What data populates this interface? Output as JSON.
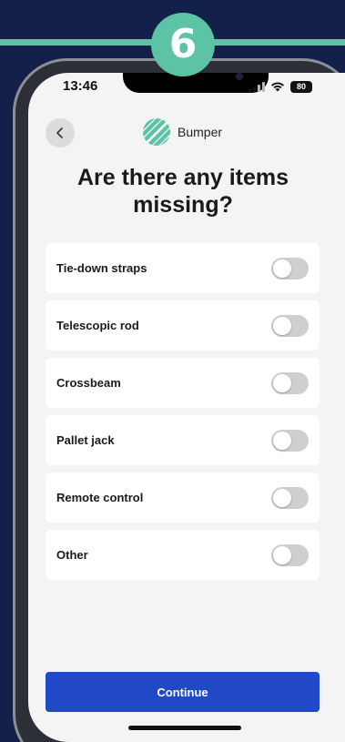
{
  "step": {
    "number": "6"
  },
  "status_bar": {
    "time": "13:46",
    "battery": "80"
  },
  "header": {
    "brand": "Bumper"
  },
  "title": "Are there any items missing?",
  "items": [
    {
      "label": "Tie-down straps",
      "enabled": false
    },
    {
      "label": "Telescopic rod",
      "enabled": false
    },
    {
      "label": "Crossbeam",
      "enabled": false
    },
    {
      "label": "Pallet jack",
      "enabled": false
    },
    {
      "label": "Remote control",
      "enabled": false
    },
    {
      "label": "Other",
      "enabled": false
    }
  ],
  "continue_label": "Continue",
  "colors": {
    "accent_green": "#5cc3a4",
    "background_navy": "#13204a",
    "button_blue": "#2148c6",
    "toggle_off": "#cfcfcf"
  },
  "icons": {
    "back": "chevron-left-icon",
    "logo": "bumper-logo-icon",
    "signal": "signal-icon",
    "wifi": "wifi-icon",
    "battery": "battery-icon"
  }
}
